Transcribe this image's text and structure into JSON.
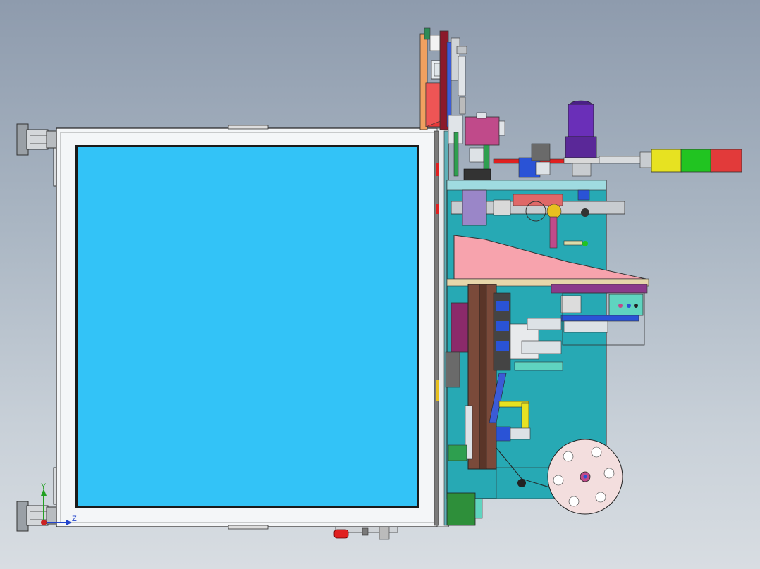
{
  "triad": {
    "y_label": "Y",
    "z_label": "Z",
    "y_color": "#22a022",
    "z_color": "#2244cc",
    "x_color": "#cc2222"
  },
  "colors": {
    "background_top": "#8e9bad",
    "background_bottom": "#d8dde2",
    "window_frame": "#f4f6f8",
    "window_glass": "#33c3f7",
    "teal_plate": "#27a9b4",
    "pink_hopper": "#f7a3ad",
    "tower_light_yellow": "#e7e221",
    "tower_light_green": "#21c421",
    "tower_light_red": "#e23a3a",
    "motor_purple": "#6a2fb8"
  },
  "icons": {
    "triad": "coordinate-axes-icon"
  }
}
